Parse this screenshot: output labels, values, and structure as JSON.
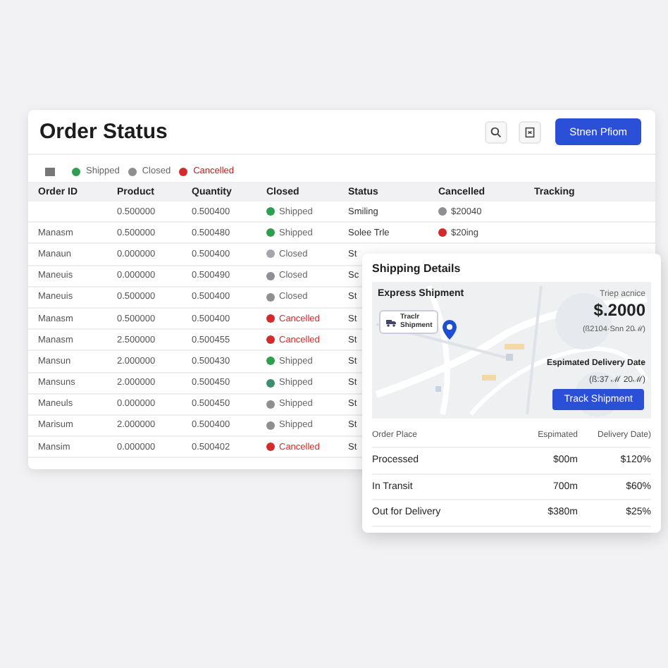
{
  "header": {
    "title": "Order Status",
    "primary_button": "Stnen Pfiom"
  },
  "legend": [
    {
      "label": "Shipped",
      "color": "#2e9e4f"
    },
    {
      "label": "Closed",
      "color": "#8e8e93"
    },
    {
      "label": "Cancelled",
      "color": "#d42a2a"
    }
  ],
  "table": {
    "columns": [
      "Order ID",
      "Product",
      "Quantity",
      "Closed",
      "Status",
      "Cancelled",
      "Tracking"
    ],
    "rows": [
      {
        "order_id": "",
        "product": "0.500000",
        "quantity": "0.500400",
        "closed": {
          "label": "Shipped",
          "color": "#2e9e4f",
          "kind": "normal"
        },
        "status": "Smiling",
        "cancelled": {
          "label": "$20040",
          "color": "#8e8e93"
        }
      },
      {
        "order_id": "Manasm",
        "product": "0.500000",
        "quantity": "0.500480",
        "closed": {
          "label": "Shipped",
          "color": "#2e9e4f",
          "kind": "normal"
        },
        "status": "Solee Trle",
        "cancelled": {
          "label": "$20ing",
          "color": "#d42a2a"
        }
      },
      {
        "order_id": "Manaun",
        "product": "0.000000",
        "quantity": "0.500400",
        "closed": {
          "label": "Closed",
          "color": "#a5a5aa",
          "kind": "normal"
        },
        "status": "St"
      },
      {
        "order_id": "Maneuis",
        "product": "0.000000",
        "quantity": "0.500490",
        "closed": {
          "label": "Closed",
          "color": "#8e8e93",
          "kind": "normal"
        },
        "status": "Sc"
      },
      {
        "order_id": "Maneuis",
        "product": "0.500000",
        "quantity": "0.500400",
        "closed": {
          "label": "Closed",
          "color": "#8e8e93",
          "kind": "normal"
        },
        "status": "St"
      },
      {
        "order_id": "Manasm",
        "product": "0.500000",
        "quantity": "0.500400",
        "closed": {
          "label": "Cancelled",
          "color": "#d42a2a",
          "kind": "alert"
        },
        "status": "St"
      },
      {
        "order_id": "Manasm",
        "product": "2.500000",
        "quantity": "0.500455",
        "closed": {
          "label": "Cancelled",
          "color": "#d42a2a",
          "kind": "alert"
        },
        "status": "St"
      },
      {
        "order_id": "Mansun",
        "product": "2.000000",
        "quantity": "0.500430",
        "closed": {
          "label": "Shipped",
          "color": "#2e9e4f",
          "kind": "normal"
        },
        "status": "St"
      },
      {
        "order_id": "Mansuns",
        "product": "2.000000",
        "quantity": "0.500450",
        "closed": {
          "label": "Shipped",
          "color": "#3d8f6a",
          "kind": "normal"
        },
        "status": "St"
      },
      {
        "order_id": "Maneuls",
        "product": "0.000000",
        "quantity": "0.500450",
        "closed": {
          "label": "Shipped",
          "color": "#8e8e93",
          "kind": "normal"
        },
        "status": "St"
      },
      {
        "order_id": "Marisum",
        "product": "2.000000",
        "quantity": "0.500400",
        "closed": {
          "label": "Shipped",
          "color": "#8e8e93",
          "kind": "normal"
        },
        "status": "St"
      },
      {
        "order_id": "Mansim",
        "product": "0.000000",
        "quantity": "0.500402",
        "closed": {
          "label": "Cancelled",
          "color": "#d42a2a",
          "kind": "alert"
        },
        "status": "St"
      }
    ]
  },
  "shipping": {
    "title": "Shipping Details",
    "map_label": "Express Shipment",
    "map_chip": "Traclr Shipment",
    "price_caption": "Triep acnice",
    "price": "$.2000",
    "price_note": "(ß2104·Snn 20ℳ)",
    "date_label": "Espimated Delivery Date",
    "date_value": "(ß:37 ℳ 20ℳ)",
    "track_button": "Track Shipment",
    "columns": [
      "Order Place",
      "Espimated",
      "Delivery Date)"
    ],
    "rows": [
      {
        "place": "Processed",
        "estimated": "$00m",
        "delivery": "$120%"
      },
      {
        "place": "In Transit",
        "estimated": "700m",
        "delivery": "$60%"
      },
      {
        "place": "Out for Delivery",
        "estimated": "$380m",
        "delivery": "$25%"
      }
    ]
  }
}
